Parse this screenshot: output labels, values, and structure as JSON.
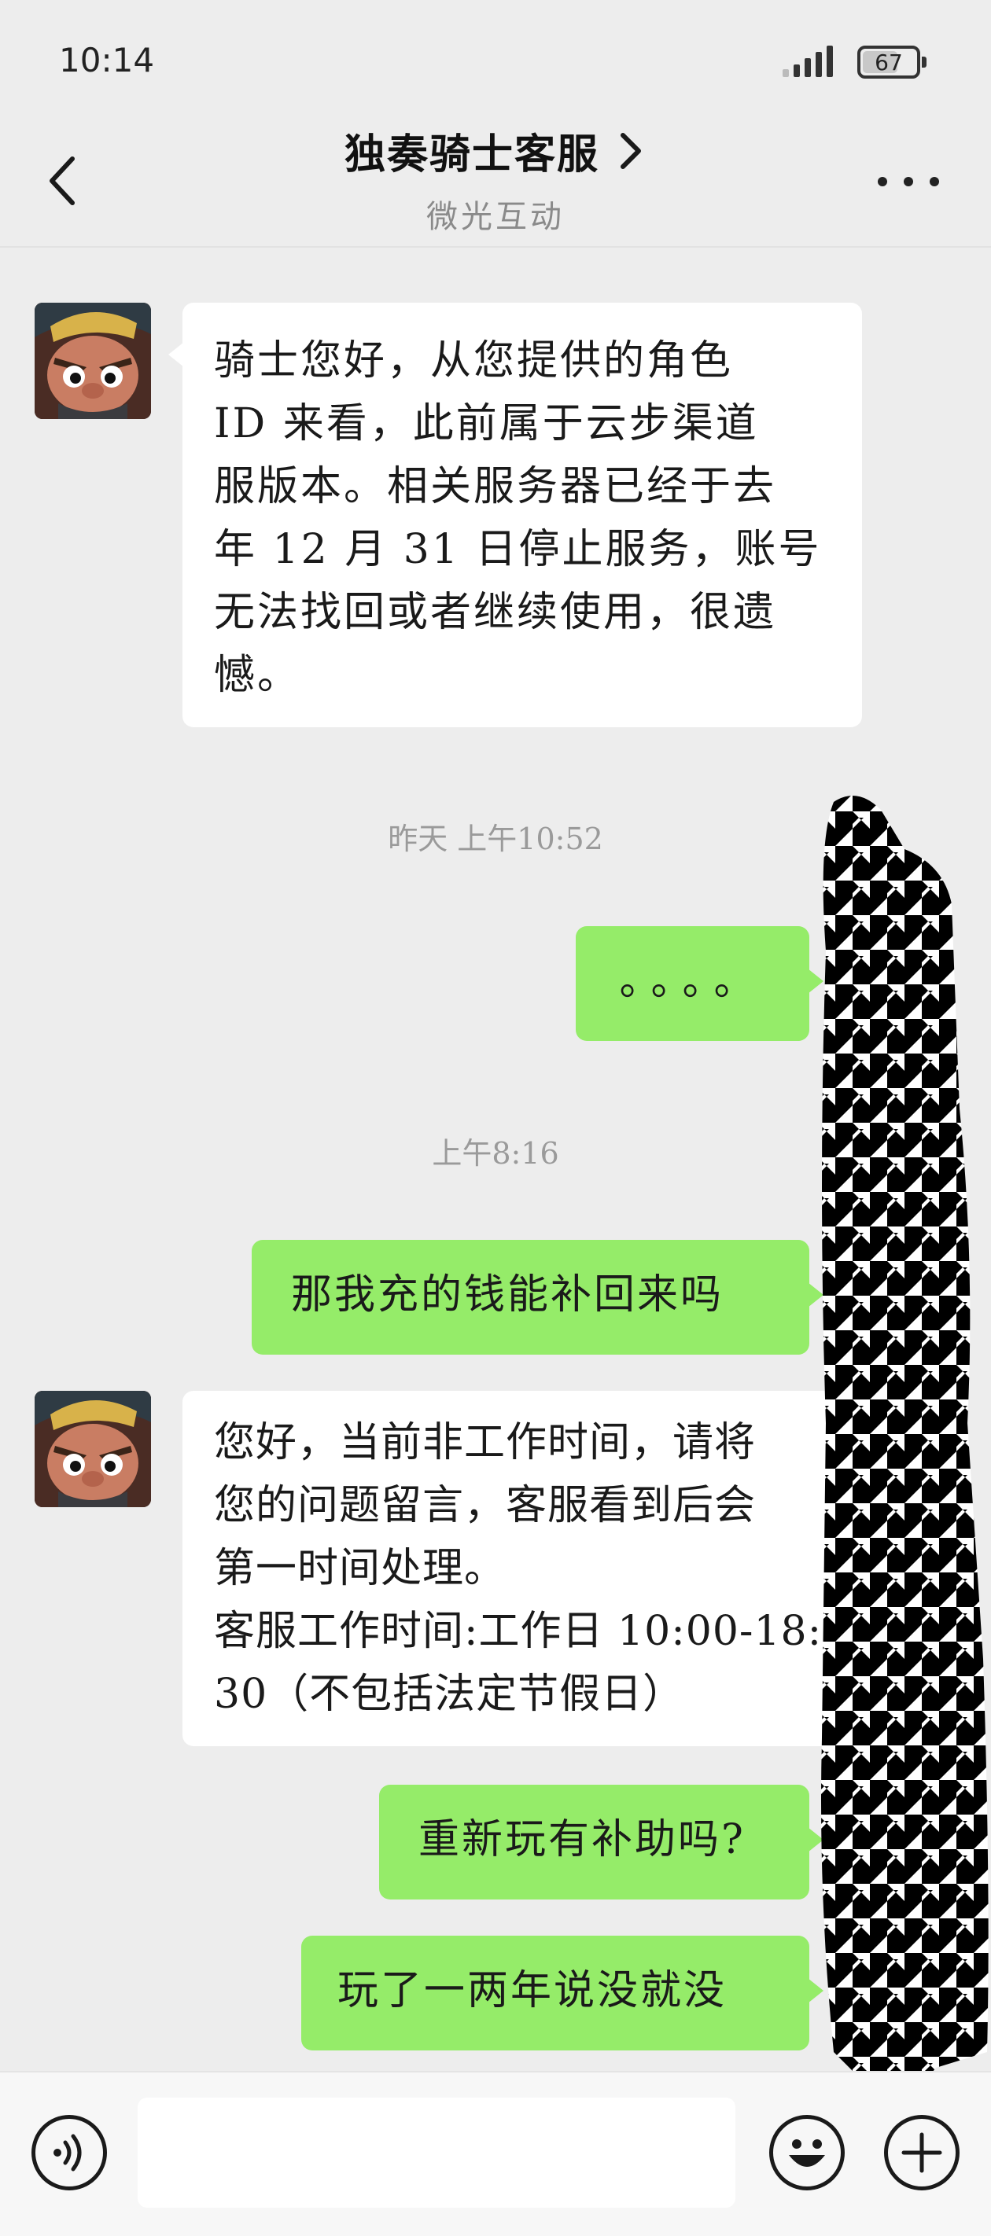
{
  "status_bar": {
    "time": "10:14",
    "battery": "67",
    "battery_fraction": 0.67
  },
  "nav": {
    "title": "独奏骑士客服",
    "subtitle": "微光互动"
  },
  "messages": [
    {
      "side": "in",
      "text": "骑士您好，从您提供的角色\nID 来看，此前属于云步渠道\n服版本。相关服务器已经于去\n年 12 月 31 日停止服务，账号\n无法找回或者继续使用，很遗\n憾。"
    },
    {
      "timestamp": "昨天  上午10:52"
    },
    {
      "side": "out",
      "text": "。。。。"
    },
    {
      "timestamp": "上午8:16"
    },
    {
      "side": "out",
      "text": "那我充的钱能补回来吗"
    },
    {
      "side": "in",
      "text": "您好，当前非工作时间，请将\n您的问题留言，客服看到后会\n第一时间处理。\n客服工作时间:工作日 10:00-18:\n30（不包括法定节假日）"
    },
    {
      "side": "out",
      "text": "重新玩有补助吗?"
    },
    {
      "side": "out",
      "text": "玩了一两年说没就没"
    }
  ],
  "input_bar": {
    "placeholder": ""
  },
  "colors": {
    "background": "#ededed",
    "incoming_bubble": "#ffffff",
    "outgoing_bubble": "#95ec69",
    "timestamp": "#9a9a9a"
  },
  "icons": [
    "signal-icon",
    "battery-icon",
    "back-arrow-icon",
    "chevron-right-icon",
    "more-icon",
    "voice-icon",
    "emoji-icon",
    "plus-icon"
  ]
}
